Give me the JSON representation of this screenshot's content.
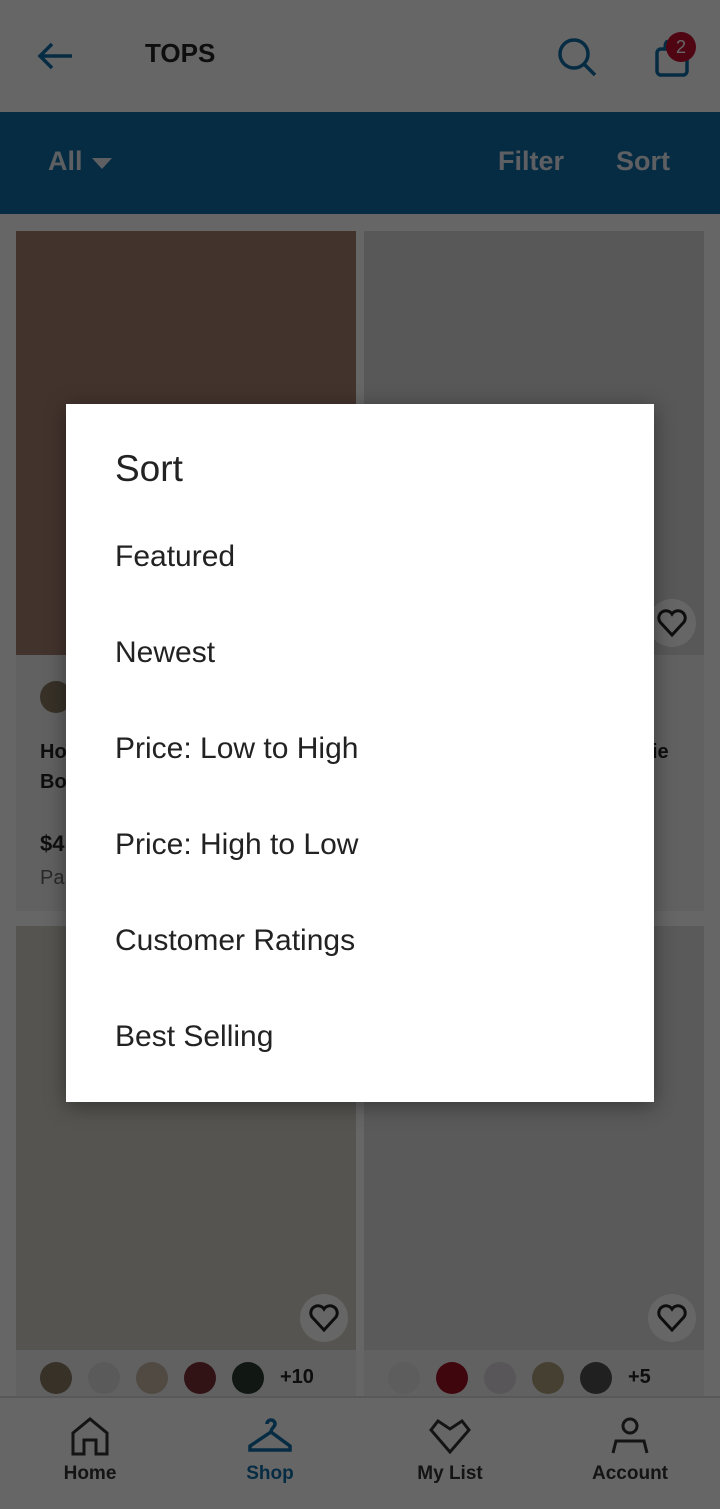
{
  "header": {
    "title": "TOPS",
    "cart_count": "2"
  },
  "filter_bar": {
    "category": "All",
    "filter": "Filter",
    "sort": "Sort"
  },
  "cards": [
    {
      "name_line1": "Ho",
      "name_line2": "Bo",
      "price": "$4",
      "sub": "Pa"
    },
    {
      "name_line1": "ie"
    }
  ],
  "swatches": {
    "left_more": "+10",
    "right_more": "+5"
  },
  "nav": [
    {
      "label": "Home",
      "icon": "home-icon"
    },
    {
      "label": "Shop",
      "icon": "hanger-icon",
      "active": true
    },
    {
      "label": "My List",
      "icon": "heart-icon"
    },
    {
      "label": "Account",
      "icon": "person-icon"
    }
  ],
  "sort_dialog": {
    "title": "Sort",
    "options": [
      "Featured",
      "Newest",
      "Price: Low to High",
      "Price: High to Low",
      "Customer Ratings",
      "Best Selling"
    ]
  },
  "colors": {
    "accent": "#0f6ea8",
    "active_nav": "#0a4a6e",
    "badge": "#c8102e"
  }
}
